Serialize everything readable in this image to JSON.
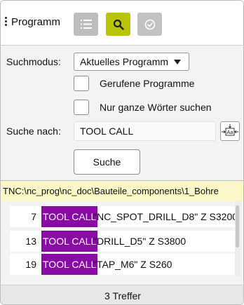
{
  "toolbar": {
    "title": "Programm",
    "list_icon": "list-icon",
    "search_icon": "search-icon",
    "check_icon": "check-circle-icon"
  },
  "form": {
    "mode_label": "Suchmodus:",
    "mode_value": "Aktuelles Programm",
    "option_called": "Gerufene Programme",
    "option_whole_words": "Nur ganze Wörter suchen",
    "search_label": "Suche nach:",
    "search_value": "TOOL CALL",
    "search_button": "Suche",
    "case_icon": "match-case-icon"
  },
  "results": {
    "path": "TNC:\\nc_prog\\nc_doc\\Bauteile_components\\1_Bohre",
    "rows": [
      {
        "line": "7",
        "keyword": "TOOL CALL",
        "rest": "\"NC_SPOT_DRILL_D8\" Z S3200"
      },
      {
        "line": "13",
        "keyword": "TOOL CALL",
        "rest": "\"DRILL_D5\" Z S3800"
      },
      {
        "line": "19",
        "keyword": "TOOL CALL",
        "rest": "\"TAP_M6\" Z S260"
      }
    ],
    "status": "3 Treffer"
  },
  "colors": {
    "accent": "#b9c406",
    "highlight": "#8a0aa6",
    "path_bar": "#fbf7c8"
  }
}
